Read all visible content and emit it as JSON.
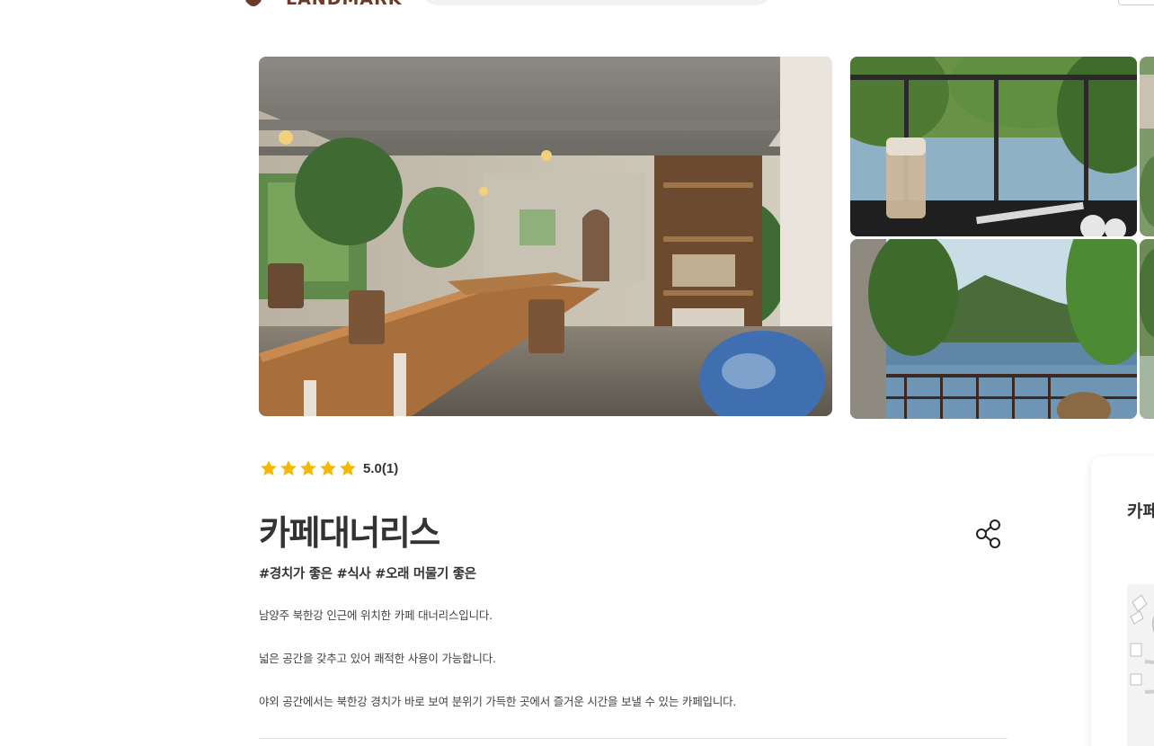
{
  "header": {
    "logo_text": "LANDMARK",
    "brand_color": "#6b3a2a"
  },
  "gallery": {
    "photos": [
      {
        "name": "cafe interior"
      },
      {
        "name": "iced coffee by railing"
      },
      {
        "name": "river and mountain view"
      }
    ]
  },
  "place": {
    "rating_stars": 5,
    "rating_text": "5.0(1)",
    "star_color": "#f5b800",
    "title": "카페대너리스",
    "tags": "#경치가 좋은 #식사 #오래 머물기 좋은",
    "description": [
      "남양주 북한강 인근에 위치한 카페 대너리스입니다.",
      "넓은 공간을 갖추고 있어 쾌적한 사용이 가능합니다.",
      "야외 공간에서는 북한강 경치가 바로 보여 분위기 가득한 곳에서 즐거운 시간을 보낼 수 있는 카페입니다."
    ]
  },
  "side_card": {
    "title": "카페대너리스"
  }
}
